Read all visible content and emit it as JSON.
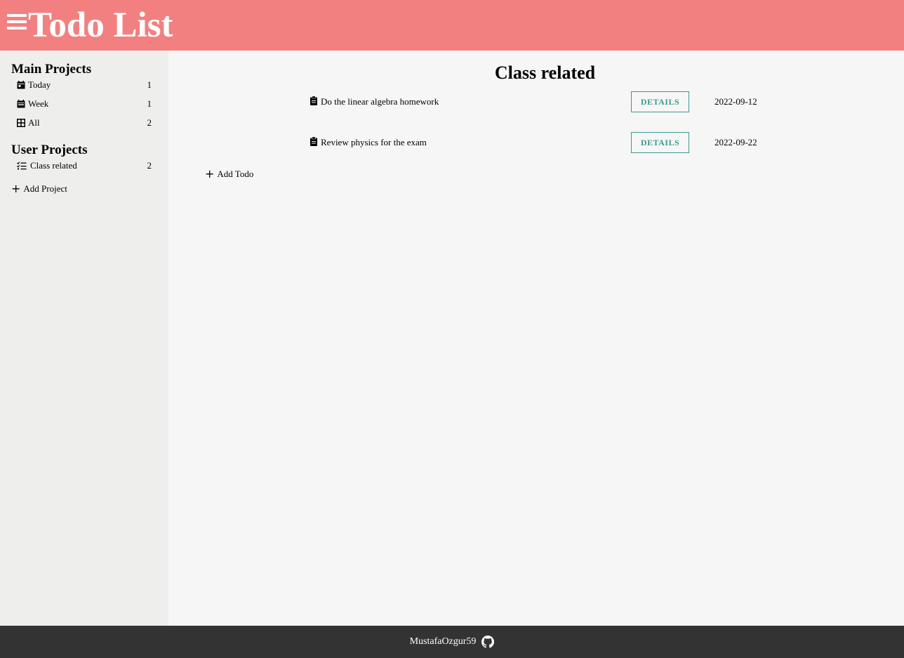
{
  "header": {
    "title": "Todo List"
  },
  "sidebar": {
    "main_heading": "Main Projects",
    "main_items": [
      {
        "label": "Today",
        "count": "1",
        "icon": "calendar-day-icon"
      },
      {
        "label": "Week",
        "count": "1",
        "icon": "calendar-week-icon"
      },
      {
        "label": "All",
        "count": "2",
        "icon": "grid-icon"
      }
    ],
    "user_heading": "User Projects",
    "user_items": [
      {
        "label": "Class related",
        "count": "2",
        "icon": "checklist-icon"
      }
    ],
    "add_project_label": "Add Project"
  },
  "main": {
    "project_title": "Class related",
    "todos": [
      {
        "title": "Do the linear algebra homework",
        "details_label": "DETAILS",
        "date": "2022-09-12"
      },
      {
        "title": "Review physics for the exam",
        "details_label": "DETAILS",
        "date": "2022-09-22"
      }
    ],
    "add_todo_label": "Add Todo"
  },
  "footer": {
    "author": "MustafaOzgur59"
  },
  "colors": {
    "header": "#f28080",
    "sidebar": "#eeeeec",
    "accent": "#3a9a8e",
    "footer": "#333333"
  }
}
